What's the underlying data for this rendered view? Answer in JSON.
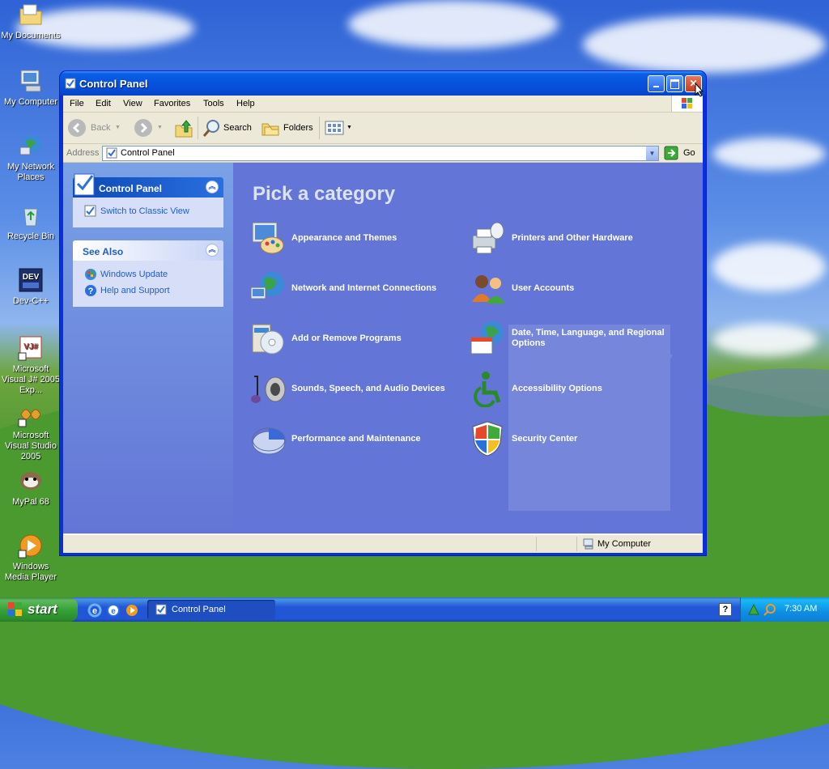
{
  "desktop": {
    "icons": [
      {
        "label": "My Documents"
      },
      {
        "label": "My Computer"
      },
      {
        "label": "My Network Places"
      },
      {
        "label": "Recycle Bin"
      },
      {
        "label": "Dev-C++"
      },
      {
        "label": "Microsoft Visual J# 2005 Exp..."
      },
      {
        "label": "Microsoft Visual Studio 2005"
      },
      {
        "label": "MyPal 68"
      },
      {
        "label": "Windows Media Player"
      }
    ]
  },
  "window": {
    "title": "Control Panel",
    "menu": [
      "File",
      "Edit",
      "View",
      "Favorites",
      "Tools",
      "Help"
    ],
    "toolbar": {
      "back": "Back",
      "search": "Search",
      "folders": "Folders"
    },
    "address": {
      "label": "Address",
      "value": "Control Panel",
      "go": "Go"
    },
    "taskpane": {
      "control_panel": {
        "title": "Control Panel",
        "link": "Switch to Classic View"
      },
      "see_also": {
        "title": "See Also",
        "links": [
          "Windows Update",
          "Help and Support"
        ]
      }
    },
    "main": {
      "heading": "Pick a category",
      "categories": [
        {
          "label": "Appearance and Themes",
          "icon": "appearance-themes-icon"
        },
        {
          "label": "Printers and Other Hardware",
          "icon": "printers-hardware-icon"
        },
        {
          "label": "Network and Internet Connections",
          "icon": "network-internet-icon"
        },
        {
          "label": "User Accounts",
          "icon": "user-accounts-icon"
        },
        {
          "label": "Add or Remove Programs",
          "icon": "add-remove-programs-icon"
        },
        {
          "label": "Date, Time, Language, and Regional Options",
          "icon": "date-time-language-icon"
        },
        {
          "label": "Sounds, Speech, and Audio Devices",
          "icon": "sounds-speech-audio-icon"
        },
        {
          "label": "Accessibility Options",
          "icon": "accessibility-icon"
        },
        {
          "label": "Performance and Maintenance",
          "icon": "performance-maintenance-icon"
        },
        {
          "label": "Security Center",
          "icon": "security-center-icon"
        }
      ]
    },
    "status": {
      "location": "My Computer"
    }
  },
  "taskbar": {
    "start": "start",
    "tasks": [
      {
        "label": "Control Panel"
      }
    ],
    "clock": "7:30 AM"
  }
}
